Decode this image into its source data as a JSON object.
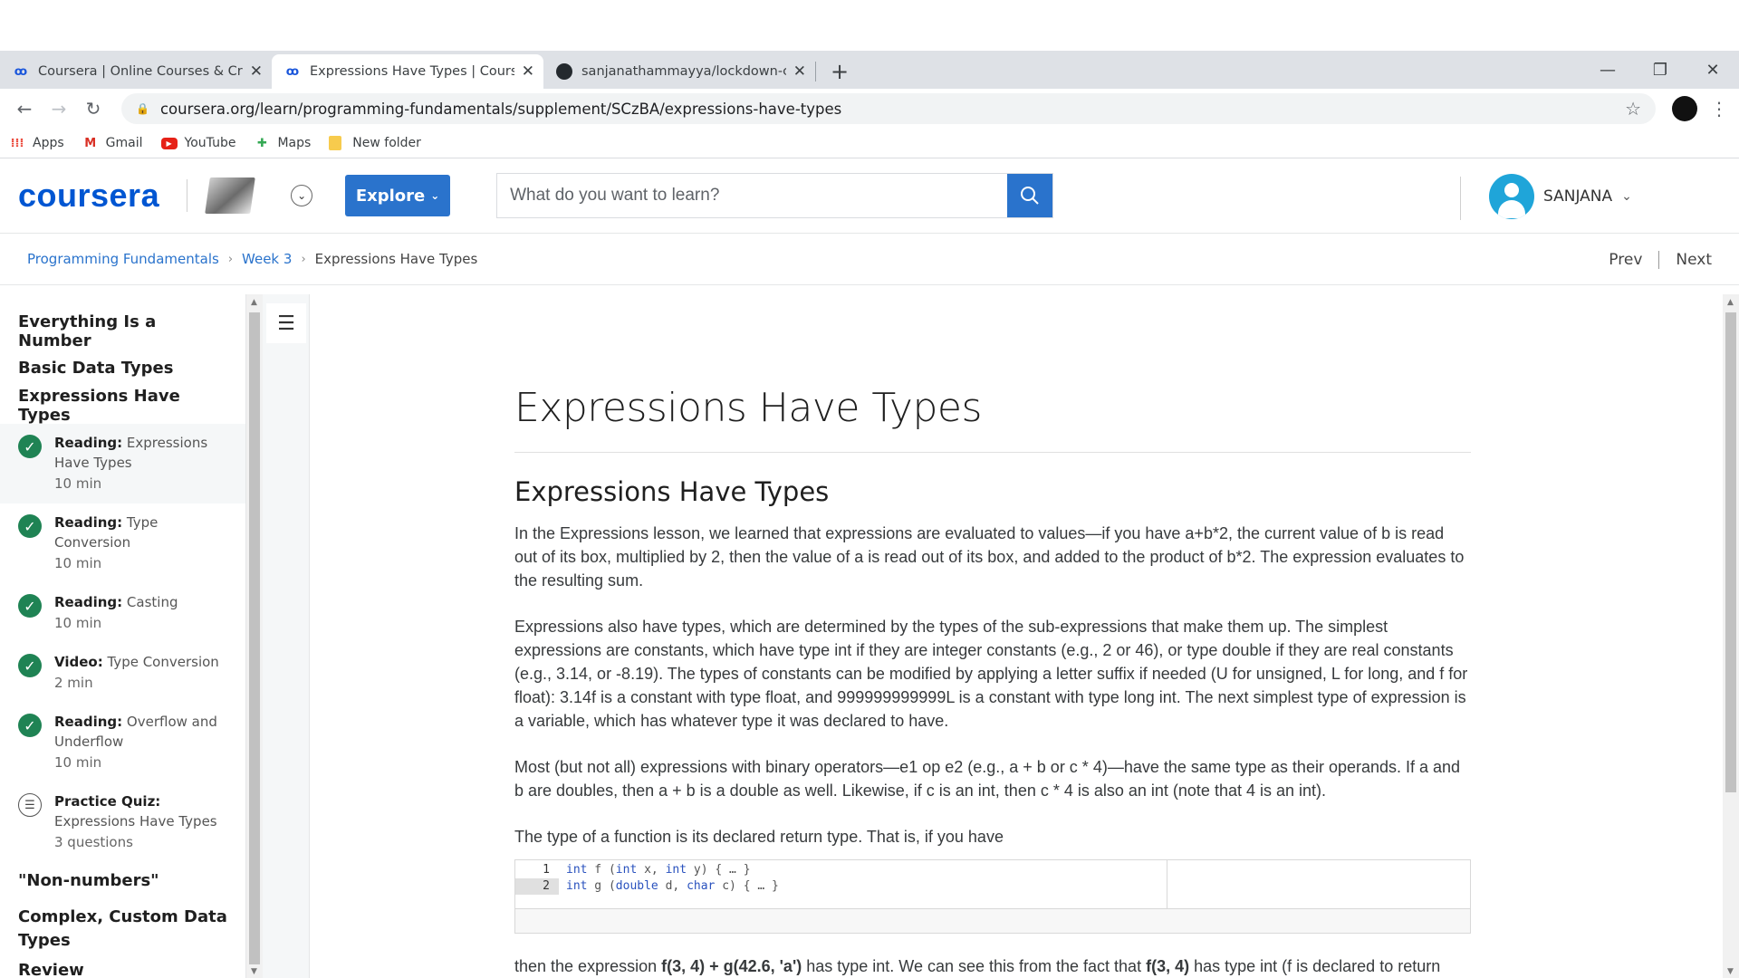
{
  "browser": {
    "tabs": [
      {
        "title": "Coursera | Online Courses & Credentials",
        "icon": "coursera-icon"
      },
      {
        "title": "Expressions Have Types | Coursera",
        "icon": "coursera-icon"
      },
      {
        "title": "sanjanathammayya/lockdown-ce",
        "icon": "github-icon"
      }
    ],
    "url": "coursera.org/learn/programming-fundamentals/supplement/SCzBA/expressions-have-types",
    "bookmarks": [
      {
        "label": "Apps",
        "icon": "apps-grid-icon"
      },
      {
        "label": "Gmail",
        "icon": "gmail-icon"
      },
      {
        "label": "YouTube",
        "icon": "youtube-icon"
      },
      {
        "label": "Maps",
        "icon": "maps-icon"
      },
      {
        "label": "New folder",
        "icon": "folder-icon"
      }
    ]
  },
  "header": {
    "logo": "coursera",
    "explore_label": "Explore",
    "search_placeholder": "What do you want to learn?",
    "user_name": "SANJANA"
  },
  "breadcrumb": {
    "course": "Programming Fundamentals",
    "week": "Week 3",
    "current": "Expressions Have Types",
    "prev": "Prev",
    "next": "Next"
  },
  "sidebar": {
    "sections_top": [
      "Everything Is a Number",
      "Basic Data Types",
      "Expressions Have Types"
    ],
    "lessons": [
      {
        "type": "Reading:",
        "title": "Expressions Have Types",
        "line1": "Expressions",
        "line2": "Have Types",
        "duration": "10 min",
        "icon": "check-icon"
      },
      {
        "type": "Reading:",
        "line1": "Type",
        "line2": "Conversion",
        "duration": "10 min",
        "icon": "check-icon"
      },
      {
        "type": "Reading:",
        "line1": "Casting",
        "line2": "",
        "duration": "10 min",
        "icon": "check-icon"
      },
      {
        "type": "Video:",
        "line1": "Type Conversion",
        "line2": "",
        "duration": "2 min",
        "icon": "check-icon"
      },
      {
        "type": "Reading:",
        "line1": "Overflow and",
        "line2": "Underflow",
        "duration": "10 min",
        "icon": "check-icon"
      },
      {
        "type": "Practice Quiz:",
        "line1": "",
        "line2": "Expressions Have Types",
        "duration": "3 questions",
        "icon": "quiz-icon"
      }
    ],
    "sections_bottom": [
      "\"Non-numbers\"",
      "Complex, Custom Data",
      "Types",
      "Review"
    ]
  },
  "content": {
    "h1": "Expressions Have Types",
    "h2": "Expressions Have Types",
    "paragraphs": [
      "In the Expressions lesson, we learned that expressions are evaluated to values—if you have a+b*2, the current value of b is read out of its box, multiplied by 2, then the value of a is read out of its box, and added to the product of b*2. The expression evaluates to the resulting sum.",
      "Expressions also have types, which are determined by the types of the sub-expressions that make them up. The simplest expressions are constants, which have type int if they are integer constants (e.g., 2 or 46), or type double if they are real constants (e.g., 3.14, or -8.19). The types of constants can be modified by applying a letter suffix if needed (U for unsigned, L for long, and f for float): 3.14f is a constant with type float, and 999999999999L is a constant with type long int. The next simplest type of expression is a variable, which has whatever type it was declared to have.",
      "Most (but not all) expressions with binary operators—e1 op e2 (e.g., a + b or c * 4)—have the same type as their operands. If a and b are doubles, then a + b is a double as well. Likewise, if c is an int, then c * 4 is also an int (note that 4 is an int).",
      "The type of a function is its declared return type. That is, if you have"
    ],
    "code": {
      "line_numbers": [
        "1",
        "2"
      ],
      "lines": [
        "int f (int x, int y) { … }",
        "int g (double d, char c) { … }"
      ]
    },
    "last_line_parts": [
      "then the expression ",
      "f(3, 4) + g(42.6, 'a')",
      " has type int. We can see this from the fact that ",
      "f(3, 4)",
      " has type int (f is declared to return"
    ]
  },
  "colors": {
    "brand": "#0056d2",
    "accent": "#2a73cc",
    "complete": "#1f8354"
  }
}
